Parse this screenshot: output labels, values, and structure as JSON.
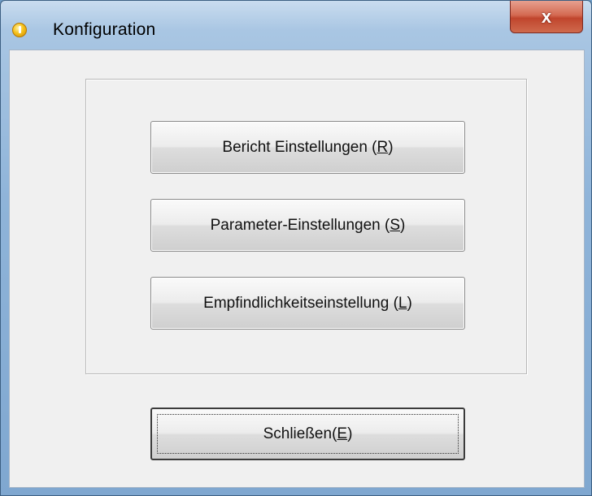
{
  "window": {
    "title": "Konfiguration",
    "close_glyph": "x",
    "icon": "info-icon"
  },
  "buttons": {
    "report": {
      "label": "Bericht Einstellungen (",
      "accel": "R",
      "suffix": ")"
    },
    "parameter": {
      "label": "Parameter-Einstellungen (",
      "accel": "S",
      "suffix": ")"
    },
    "sensitivity": {
      "label": "Empfindlichkeitseinstellung (",
      "accel": "L",
      "suffix": ")"
    },
    "close": {
      "label": "Schließen(",
      "accel": "E",
      "suffix": ")"
    }
  }
}
